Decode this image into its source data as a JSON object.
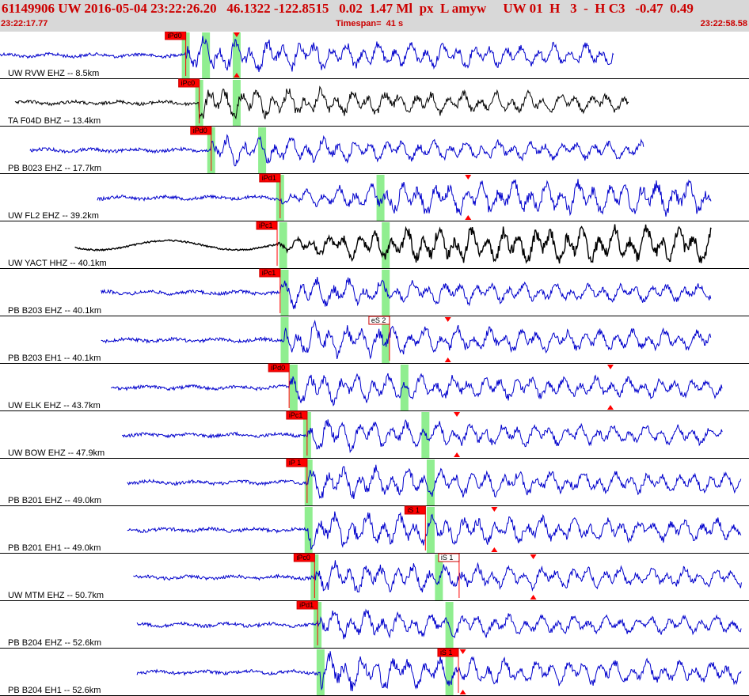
{
  "header": {
    "title": "61149906 UW 2016-05-04 23:22:26.20   46.1322 -122.8515   0.02  1.47 Ml  px  L amyw     UW 01  H   3  -  H C3   -0.47  0.49",
    "start_time": "23:22:17.77",
    "timespan": "Timespan=  41 s",
    "end_time": "23:22:58.58"
  },
  "colors": {
    "trace_blue": "#0000cc",
    "trace_black": "#000000",
    "pick_fill": "#ff0000",
    "pick_outline": "#cc0000",
    "window_green": "#90ee90",
    "header_bg": "#d8d8d8",
    "header_text": "#cc0000"
  },
  "chart_data": {
    "type": "line",
    "x_range_s": [
      0,
      41
    ],
    "traces": [
      {
        "label": "UW RVW EHZ -- 8.5km",
        "color": "blue",
        "start": 0.0,
        "end": 0.82,
        "onset": 0.248,
        "pick": {
          "text": "iPd0",
          "at": 0.248
        },
        "green": [
          0.248,
          0.275,
          0.316
        ],
        "marker": 0.316,
        "amp": 0.75
      },
      {
        "label": "TA F04D BHZ -- 13.4km",
        "color": "black",
        "start": 0.02,
        "end": 0.84,
        "onset": 0.266,
        "pick": {
          "text": "iPc0",
          "at": 0.266
        },
        "green": [
          0.266,
          0.316
        ],
        "amp": 0.7
      },
      {
        "label": "PB B023 EHZ -- 17.7km",
        "color": "blue",
        "start": 0.04,
        "end": 0.86,
        "onset": 0.282,
        "pick": {
          "text": "iPd0",
          "at": 0.282
        },
        "green": [
          0.282,
          0.35
        ],
        "amp": 0.6
      },
      {
        "label": "UW FL2 EHZ -- 39.2km",
        "color": "blue",
        "start": 0.13,
        "end": 0.95,
        "onset": 0.374,
        "pick": {
          "text": "iPd1",
          "at": 0.374
        },
        "green": [
          0.374,
          0.508
        ],
        "marker": 0.625,
        "amp": 0.7,
        "late_amp": true
      },
      {
        "label": "UW YACT HHZ -- 40.1km",
        "color": "black",
        "start": 0.1,
        "end": 0.95,
        "onset": 0.37,
        "pick": {
          "text": "iPc1",
          "at": 0.37
        },
        "green": [
          0.378,
          0.515
        ],
        "amp": 0.75,
        "late_amp": true,
        "black_bold": true
      },
      {
        "label": "PB B203 EHZ -- 40.1km",
        "color": "blue",
        "start": 0.135,
        "end": 0.95,
        "onset": 0.374,
        "pick": {
          "text": "iPc1",
          "at": 0.374
        },
        "green": [
          0.38,
          0.515
        ],
        "amp": 0.6
      },
      {
        "label": "PB B203 EH1 -- 40.1km",
        "color": "blue",
        "start": 0.135,
        "end": 0.95,
        "onset": 0.38,
        "pick": {
          "text": "eS 2",
          "at": 0.52,
          "outline": true
        },
        "green": [
          0.38,
          0.515
        ],
        "marker": 0.598,
        "amp": 0.7
      },
      {
        "label": "UW ELK EHZ -- 43.7km",
        "color": "blue",
        "start": 0.148,
        "end": 0.965,
        "onset": 0.386,
        "pick": {
          "text": "iPd0",
          "at": 0.386
        },
        "green": [
          0.392,
          0.54
        ],
        "marker": 0.815,
        "amp": 0.65
      },
      {
        "label": "UW BOW EHZ -- 47.9km",
        "color": "blue",
        "start": 0.163,
        "end": 0.965,
        "onset": 0.41,
        "pick": {
          "text": "iPc1",
          "at": 0.41
        },
        "green": [
          0.41,
          0.568
        ],
        "marker": 0.61,
        "amp": 0.65
      },
      {
        "label": "PB B201 EHZ -- 49.0km",
        "color": "blue",
        "start": 0.17,
        "end": 0.99,
        "onset": 0.41,
        "pick": {
          "text": "iP 1",
          "at": 0.41
        },
        "green": [
          0.412,
          0.575
        ],
        "amp": 0.7
      },
      {
        "label": "PB B201 EH1 -- 49.0km",
        "color": "blue",
        "start": 0.17,
        "end": 0.99,
        "onset": 0.412,
        "pick": {
          "text": "iS 1",
          "at": 0.568
        },
        "green": [
          0.412,
          0.575
        ],
        "marker": 0.66,
        "amp": 0.75
      },
      {
        "label": "UW MTM EHZ -- 50.7km",
        "color": "blue",
        "start": 0.178,
        "end": 0.99,
        "onset": 0.42,
        "pick": {
          "text": "iPc0",
          "at": 0.42
        },
        "green": [
          0.42,
          0.586
        ],
        "marker": 0.712,
        "amp": 0.65,
        "pick2": {
          "text": "iS 1",
          "at": 0.613,
          "outline": true
        }
      },
      {
        "label": "PB B204 EHZ -- 52.6km",
        "color": "blue",
        "start": 0.183,
        "end": 0.99,
        "onset": 0.424,
        "pick": {
          "text": "iPd1",
          "at": 0.424
        },
        "green": [
          0.424,
          0.6
        ],
        "amp": 0.6
      },
      {
        "label": "PB B204 EH1 -- 52.6km",
        "color": "blue",
        "start": 0.183,
        "end": 0.99,
        "onset": 0.428,
        "pick": {
          "text": "iS 1",
          "at": 0.612
        },
        "green": [
          0.428,
          0.6
        ],
        "marker": 0.618,
        "amp": 0.75
      }
    ]
  }
}
